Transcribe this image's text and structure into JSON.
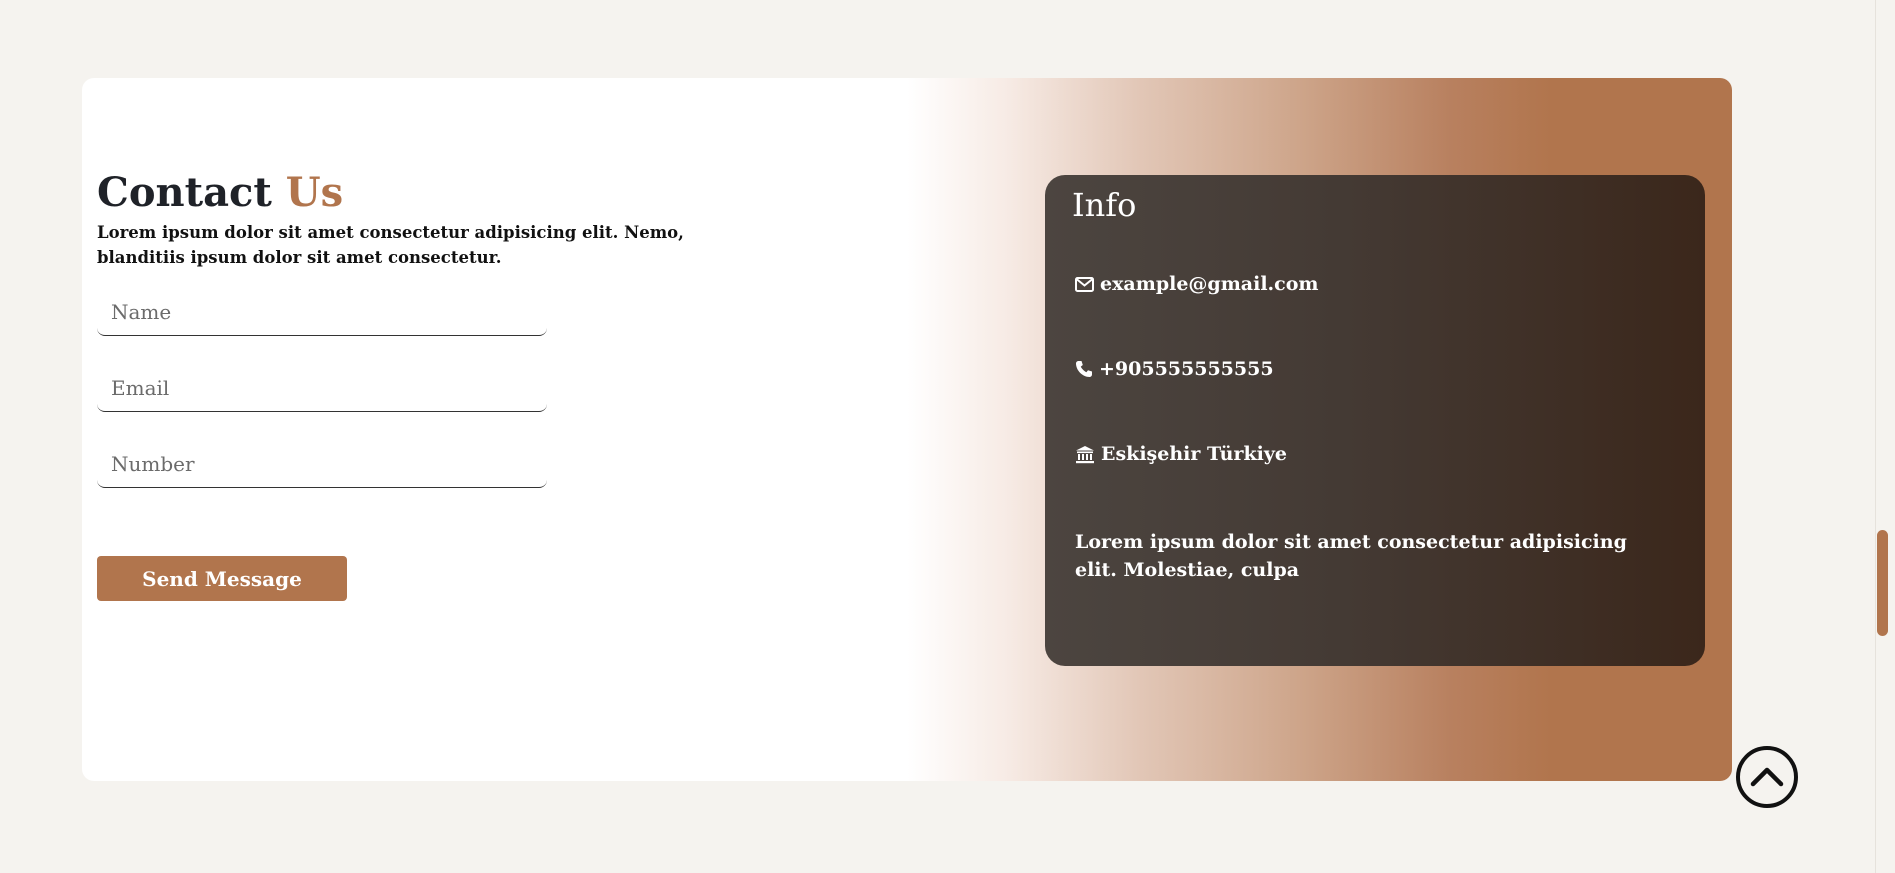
{
  "contact": {
    "title_main": "Contact",
    "title_accent": "Us",
    "description": "Lorem ipsum dolor sit amet consectetur adipisicing elit. Nemo, blanditiis ipsum dolor sit amet consectetur.",
    "fields": {
      "name_placeholder": "Name",
      "email_placeholder": "Email",
      "number_placeholder": "Number"
    },
    "send_label": "Send Message"
  },
  "info": {
    "title": "Info",
    "email": "example@gmail.com",
    "phone": "+905555555555",
    "location": "Eskişehir Türkiye",
    "text": "Lorem ipsum dolor sit amet consectetur adipisicing elit. Molestiae, culpa",
    "icons": {
      "email": "envelope-icon",
      "phone": "phone-icon",
      "location": "bank-icon"
    }
  },
  "colors": {
    "accent": "#b1754d",
    "page_bg": "#f5f3ef",
    "info_card_dark": "#3b271b"
  },
  "scroll_to_top_icon": "chevron-up-icon"
}
